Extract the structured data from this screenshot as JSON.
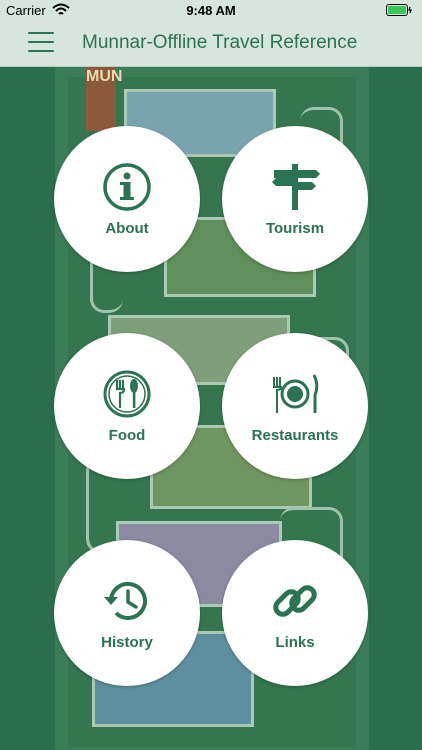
{
  "status_bar": {
    "carrier": "Carrier",
    "time": "9:48 AM"
  },
  "nav": {
    "title": "Munnar-Offline Travel Reference"
  },
  "poster": {
    "sign_text": "MUN"
  },
  "menu": [
    {
      "label": "About",
      "icon": "info-icon"
    },
    {
      "label": "Tourism",
      "icon": "signpost-icon"
    },
    {
      "label": "Food",
      "icon": "cutlery-icon"
    },
    {
      "label": "Restaurants",
      "icon": "plate-icon"
    },
    {
      "label": "History",
      "icon": "history-icon"
    },
    {
      "label": "Links",
      "icon": "link-icon"
    }
  ],
  "colors": {
    "accent": "#2b7352",
    "bar": "#d6e6dd",
    "background": "#2a6e4e"
  }
}
